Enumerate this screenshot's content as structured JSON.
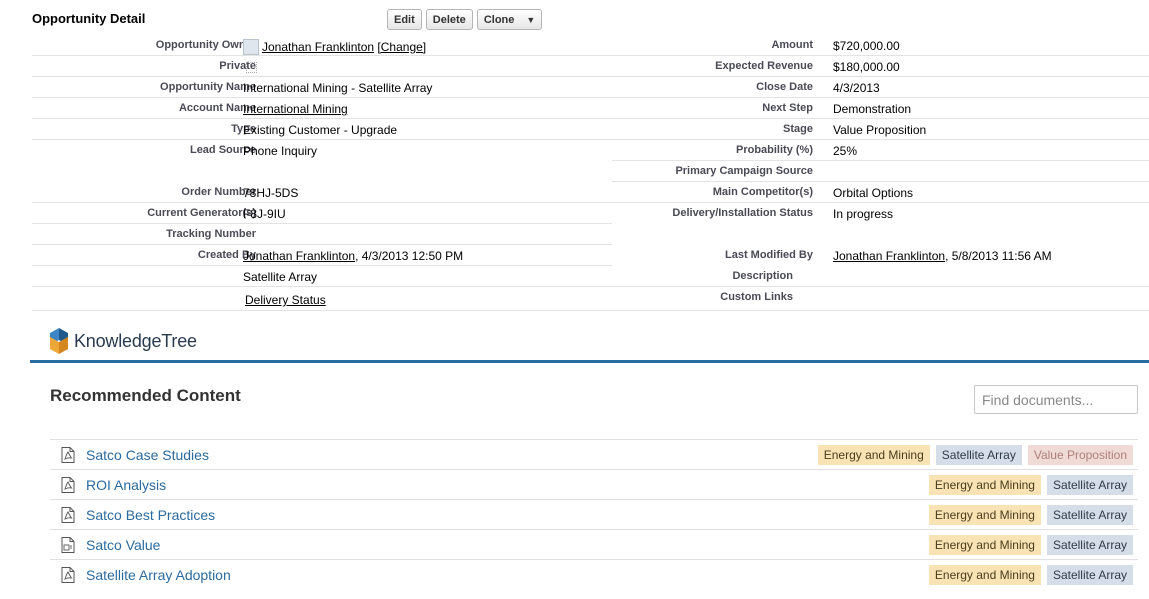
{
  "detail": {
    "title": "Opportunity Detail",
    "buttons": {
      "edit": "Edit",
      "delete": "Delete",
      "clone": "Clone"
    },
    "left": [
      {
        "label": "Opportunity Owner",
        "value": "Jonathan Franklinton",
        "change": "[Change]"
      },
      {
        "label": "Private",
        "value": ""
      },
      {
        "label": "Opportunity Name",
        "value": "International Mining - Satellite Array"
      },
      {
        "label": "Account Name",
        "value": "International Mining"
      },
      {
        "label": "Type",
        "value": "Existing Customer - Upgrade"
      },
      {
        "label": "Lead Source",
        "value": "Phone Inquiry"
      },
      {
        "label": "",
        "value": ""
      },
      {
        "label": "Order Number",
        "value": "78HJ-5DS"
      },
      {
        "label": "Current Generator(s)",
        "value": "F8J-9IU"
      },
      {
        "label": "Tracking Number",
        "value": ""
      },
      {
        "label": "Created By",
        "value": "Jonathan Franklinton",
        "suffix": ", 4/3/2013 12:50 PM"
      },
      {
        "label": "Description",
        "value": "Satellite Array"
      },
      {
        "label": "Custom Links",
        "value": "Delivery Status"
      }
    ],
    "right": [
      {
        "label": "Amount",
        "value": "$720,000.00"
      },
      {
        "label": "Expected Revenue",
        "value": "$180,000.00"
      },
      {
        "label": "Close Date",
        "value": "4/3/2013"
      },
      {
        "label": "Next Step",
        "value": "Demonstration"
      },
      {
        "label": "Stage",
        "value": "Value Proposition"
      },
      {
        "label": "Probability (%)",
        "value": "25%"
      },
      {
        "label": "Primary Campaign Source",
        "value": ""
      },
      {
        "label": "Main Competitor(s)",
        "value": "Orbital Options"
      },
      {
        "label": "Delivery/Installation Status",
        "value": "In progress"
      },
      {
        "label": "",
        "value": ""
      },
      {
        "label": "Last Modified By",
        "value": "Jonathan Franklinton",
        "suffix": ", 5/8/2013 11:56 AM"
      }
    ]
  },
  "knowledgetree": {
    "brand": "KnowledgeTree",
    "section_title": "Recommended Content",
    "search_placeholder": "Find documents...",
    "documents": [
      {
        "title": "Satco Case Studies",
        "icon": "pdf-icon",
        "tags": [
          "Energy and Mining",
          "Satellite Array",
          "Value Proposition"
        ]
      },
      {
        "title": "ROI Analysis",
        "icon": "pdf-icon",
        "tags": [
          "Energy and Mining",
          "Satellite Array"
        ]
      },
      {
        "title": "Satco Best Practices",
        "icon": "pdf-icon",
        "tags": [
          "Energy and Mining",
          "Satellite Array"
        ]
      },
      {
        "title": "Satco Value",
        "icon": "doc-icon",
        "tags": [
          "Energy and Mining",
          "Satellite Array"
        ]
      },
      {
        "title": "Satellite Array Adoption",
        "icon": "pdf-icon",
        "tags": [
          "Energy and Mining",
          "Satellite Array"
        ]
      }
    ],
    "colors": {
      "accent": "#2a6da0",
      "link": "#2b6aa0",
      "tag_industry": "#f9e3b4",
      "tag_product": "#d5dee8",
      "tag_stage": "#f0dad6"
    }
  }
}
